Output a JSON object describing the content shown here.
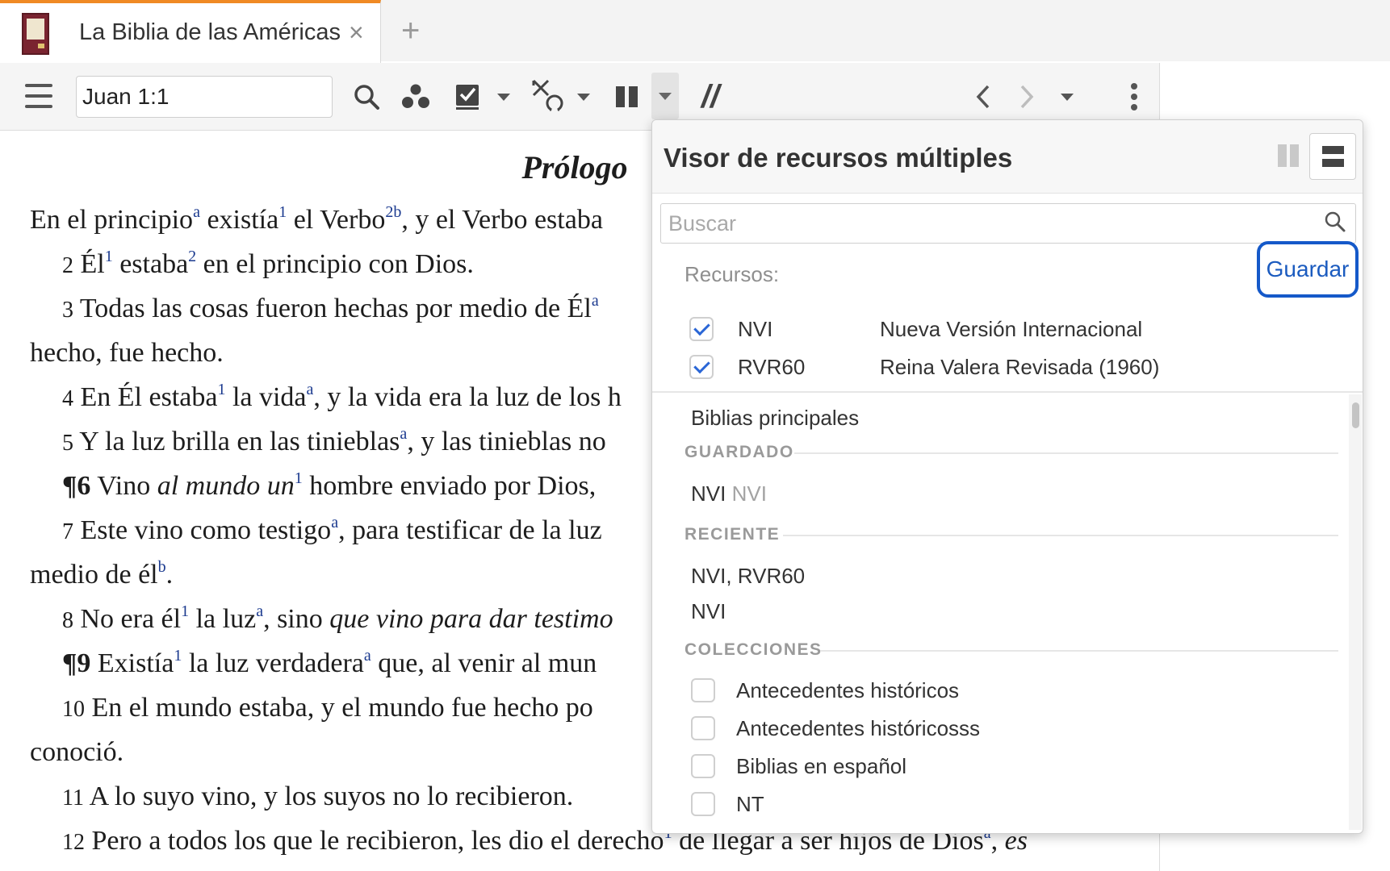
{
  "tab": {
    "title": "La Biblia de las Américas",
    "close": "×",
    "add": "+"
  },
  "toolbar": {
    "reference": "Juan 1:1",
    "slash": "//"
  },
  "scripture": {
    "heading": "Prólogo",
    "verses": [
      {
        "segments": [
          "En el principio",
          "a",
          " existía",
          "1",
          " el Verbo",
          "2b",
          ", y el Verbo estaba"
        ]
      },
      {
        "num": "2",
        "segments": [
          " Él",
          "1",
          " estaba",
          "2",
          " en el principio con Dios."
        ]
      },
      {
        "num": "3",
        "segments": [
          " Todas las cosas fueron hechas por medio de Él",
          "a"
        ]
      },
      {
        "cont": "hecho, fue hecho."
      },
      {
        "num": "4",
        "segments": [
          " En Él estaba",
          "1",
          " la vida",
          "a",
          ", y la vida era la luz de los h"
        ]
      },
      {
        "num": "5",
        "segments": [
          " Y la luz brilla en las tinieblas",
          "a",
          ", y las tinieblas no"
        ]
      },
      {
        "num": "¶6",
        "segments": [
          " Vino ",
          "",
          "al mundo",
          "",
          " un",
          "1",
          " hombre enviado por Dios,"
        ]
      },
      {
        "num": "7",
        "segments": [
          " Este vino como testigo",
          "a",
          ", para testificar de la luz"
        ]
      },
      {
        "cont": "medio de él",
        "sup": "b",
        "end": "."
      },
      {
        "num": "8",
        "segments": [
          " No era él",
          "1",
          " la luz",
          "a",
          ", sino ",
          "",
          "que vino",
          "",
          " para dar testimo"
        ]
      },
      {
        "num": "¶9",
        "segments": [
          " Existía",
          "1",
          " la luz verdadera",
          "a",
          " que, al venir al mun"
        ]
      },
      {
        "num": "10",
        "segments": [
          " En el mundo estaba, y el mundo fue hecho po"
        ]
      },
      {
        "cont": "conoció."
      },
      {
        "num": "11",
        "segments": [
          " A lo suyo vino, y los suyos no lo recibieron."
        ]
      },
      {
        "num": "12",
        "segments": [
          " Pero a todos los que le recibieron, les dio el derecho",
          "1",
          " de llegar a ser hijos de Dios",
          "a",
          ", ",
          "",
          "es"
        ]
      }
    ]
  },
  "panel": {
    "title": "Visor de recursos múltiples",
    "search_placeholder": "Buscar",
    "resources_label": "Recursos:",
    "save_label": "Guardar",
    "resources": [
      {
        "abbr": "NVI",
        "name": "Nueva Versión Internacional",
        "checked": true
      },
      {
        "abbr": "RVR60",
        "name": "Reina Valera Revisada (1960)",
        "checked": true
      }
    ],
    "main_bibles": "Biblias principales",
    "saved_header": "GUARDADO",
    "saved_item_name": "NVI",
    "saved_item_detail": "NVI",
    "recent_header": "RECIENTE",
    "recent_items": [
      "NVI, RVR60",
      "NVI"
    ],
    "collections_header": "COLECCIONES",
    "collections": [
      "Antecedentes históricos",
      "Antecedentes históricosss",
      "Biblias en español",
      "NT"
    ]
  },
  "colors": {
    "accent": "#1559c9",
    "tab_accent": "#f08a24",
    "footnote": "#1b3a8f"
  }
}
